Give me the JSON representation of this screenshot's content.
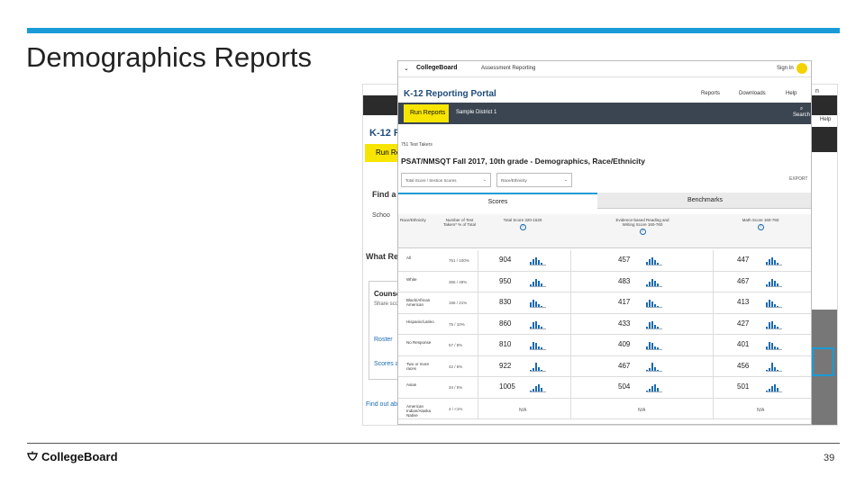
{
  "slide": {
    "title": "Demographics Reports",
    "page_number": "39",
    "footer_logo": "CollegeBoard"
  },
  "colors": {
    "accent_bar": "#1a9bd7",
    "nav_dark": "#3b4551",
    "run_button": "#f7e500",
    "portal_title": "#1f4b7a",
    "histogram": "#1a6ab1"
  },
  "back_screenshot": {
    "title": "K-12 R",
    "run_button": "Run Re",
    "find": "Find a",
    "school": "Schoo",
    "what": "What Re",
    "counselor": "Counse",
    "share": "Share sco",
    "roster": "Roster",
    "scores": "Scores a",
    "find_out": "Find out ab",
    "help": "Help",
    "n": "n"
  },
  "front_screenshot": {
    "header": {
      "menu_icon": "chevron-down-icon",
      "logo": "CollegeBoard",
      "app_title": "Assessment Reporting",
      "sign_in": "Sign In"
    },
    "portal": {
      "title": "K-12 Reporting Portal",
      "reports": "Reports",
      "downloads": "Downloads",
      "help": "Help"
    },
    "navbar": {
      "run_reports": "Run Reports",
      "district": "Sample District 1",
      "search": "Search"
    },
    "report": {
      "test_takers": "751 Test Takers",
      "title": "PSAT/NMSQT Fall 2017, 10th grade - Demographics, Race/Ethnicity",
      "select_1": "Total Score / Section Scores",
      "select_2": "Race/Ethnicity",
      "export": "EXPORT"
    },
    "tabs": [
      "Scores",
      "Benchmarks"
    ],
    "table": {
      "headers": {
        "group": "Race/Ethnicity",
        "takers": "Number of Test Takers* % of Total",
        "total": "Total Score 320-1520",
        "ebrw": "Evidence-based Reading and Writing Score 160-760",
        "math": "Math Score 160-760"
      },
      "rows": [
        {
          "group": "All",
          "takers": "751 / 100%",
          "total": "904",
          "ebrw": "457",
          "math": "447"
        },
        {
          "group": "White",
          "takers": "366 / 49%",
          "total": "950",
          "ebrw": "483",
          "math": "467"
        },
        {
          "group": "Black/African American",
          "takers": "156 / 21%",
          "total": "830",
          "ebrw": "417",
          "math": "413"
        },
        {
          "group": "Hispanic/Latino",
          "takers": "75 / 10%",
          "total": "860",
          "ebrw": "433",
          "math": "427"
        },
        {
          "group": "No Response",
          "takers": "57 / 8%",
          "total": "810",
          "ebrw": "409",
          "math": "401"
        },
        {
          "group": "Two or more races",
          "takers": "42 / 6%",
          "total": "922",
          "ebrw": "467",
          "math": "456"
        },
        {
          "group": "Asian",
          "takers": "34 / 5%",
          "total": "1005",
          "ebrw": "504",
          "math": "501"
        },
        {
          "group": "American Indian/Alaska Native",
          "takers": "4 / <1%",
          "total": "N/A",
          "ebrw": "N/A",
          "math": "N/A"
        }
      ]
    }
  }
}
